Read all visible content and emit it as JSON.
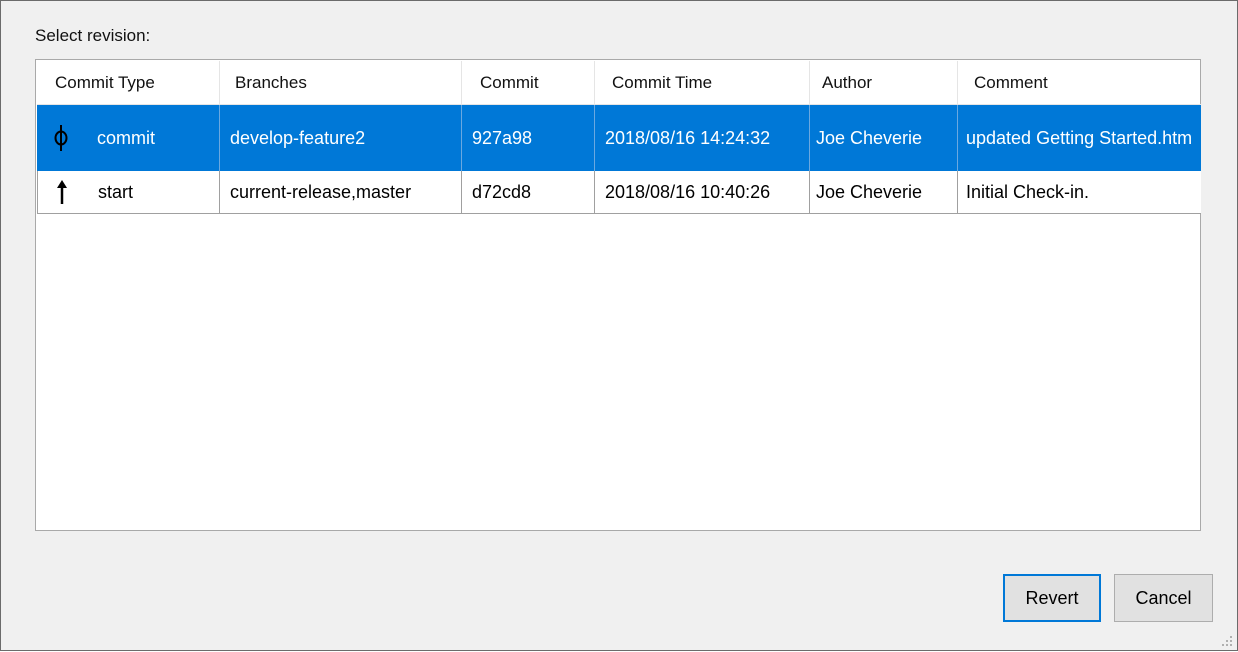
{
  "dialog": {
    "select_label": "Select revision:"
  },
  "table": {
    "headers": [
      "Commit Type",
      "Branches",
      "Commit",
      "Commit Time",
      "Author",
      "Comment"
    ],
    "rows": [
      {
        "type_icon": "commit-icon",
        "type": "commit",
        "branches": "develop-feature2",
        "commit": "927a98",
        "time": "2018/08/16 14:24:32",
        "author": "Joe Cheverie",
        "comment": "updated Getting Started.htm",
        "selected": true
      },
      {
        "type_icon": "arrow-up-icon",
        "type": "start",
        "branches": "current-release,master",
        "commit": "d72cd8",
        "time": "2018/08/16 10:40:26",
        "author": "Joe Cheverie",
        "comment": "Initial Check-in.",
        "selected": false
      }
    ]
  },
  "buttons": {
    "revert": "Revert",
    "cancel": "Cancel"
  },
  "colors": {
    "selection": "#0078d7",
    "dialog_bg": "#f0f0f0"
  }
}
